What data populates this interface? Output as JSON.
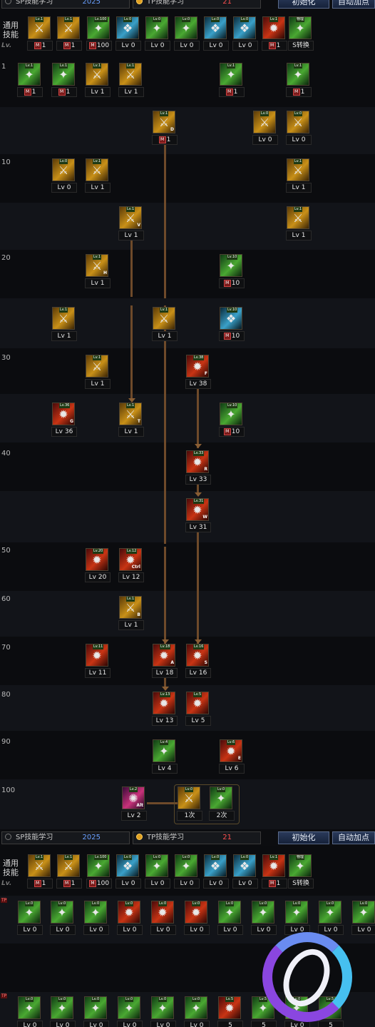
{
  "window": {
    "title": "SP技能学习 / TP技能学习"
  },
  "top_tabs": {
    "sp_label": "SP技能学习",
    "sp_points": "2025",
    "tp_label": "TP技能学习",
    "tp_points": "21",
    "reset_label": "初始化",
    "auto_label": "自动加点"
  },
  "bottom_tabs": {
    "sp_label": "SP技能学习",
    "sp_points": "2025",
    "tp_label": "TP技能学习",
    "tp_points": "21",
    "reset_label": "初始化",
    "auto_label": "自动加点"
  },
  "general_label": "通用\n技能",
  "lv_mark": "Lv.",
  "level_labels": [
    "1",
    "10",
    "20",
    "30",
    "40",
    "50",
    "60",
    "70",
    "80",
    "90",
    "100"
  ],
  "general_skills": [
    {
      "count": "1",
      "m": true,
      "hk": "",
      "tag": "Lv.1",
      "icon": "scroll-icon",
      "color": "gold"
    },
    {
      "count": "1",
      "m": true,
      "hk": "",
      "tag": "Lv.1",
      "icon": "fist-icon",
      "color": "gold"
    },
    {
      "count": "100",
      "m": true,
      "hk": "",
      "tag": "Lv.100",
      "icon": "wind-icon",
      "color": "green"
    },
    {
      "count": "Lv 0",
      "m": false,
      "hk": "",
      "tag": "Lv.0",
      "icon": "wings-icon",
      "color": "cyan"
    },
    {
      "count": "Lv 0",
      "m": false,
      "hk": "",
      "tag": "Lv.0",
      "icon": "target-icon",
      "color": "green"
    },
    {
      "count": "Lv 0",
      "m": false,
      "hk": "",
      "tag": "Lv.0",
      "icon": "figure-icon",
      "color": "green"
    },
    {
      "count": "Lv 0",
      "m": false,
      "hk": "",
      "tag": "Lv.0",
      "icon": "eye-icon",
      "color": "cyan"
    },
    {
      "count": "Lv 0",
      "m": false,
      "hk": "",
      "tag": "Lv.0",
      "icon": "armor-icon",
      "color": "cyan"
    },
    {
      "count": "1",
      "m": true,
      "hk": "",
      "tag": "Lv.1",
      "icon": "flame-icon",
      "color": "red"
    },
    {
      "count": "S转换",
      "m": false,
      "hk": "",
      "tag": "物理",
      "icon": "convert-icon",
      "color": "green"
    }
  ],
  "skills": [
    {
      "name": "skill-1-1",
      "count": "1",
      "m": true,
      "hk": "",
      "tag": "Lv.1",
      "color": "green",
      "icon": "shield-grid-icon"
    },
    {
      "name": "skill-1-2",
      "count": "1",
      "m": true,
      "hk": "",
      "tag": "Lv.1",
      "color": "green",
      "icon": "slash-icon"
    },
    {
      "name": "skill-1-3",
      "count": "Lv 1",
      "m": false,
      "hk": "",
      "tag": "Lv.1",
      "color": "gold",
      "icon": "strike-icon"
    },
    {
      "name": "skill-1-4",
      "count": "Lv 1",
      "m": false,
      "hk": "",
      "tag": "Lv.1",
      "color": "gold",
      "icon": "swing-icon"
    },
    {
      "name": "skill-1-5",
      "count": "1",
      "m": true,
      "hk": "",
      "tag": "Lv.1",
      "color": "green",
      "icon": "spin-icon"
    },
    {
      "name": "skill-1-6",
      "count": "1",
      "m": true,
      "hk": "",
      "tag": "Lv.1",
      "color": "green",
      "icon": "leaf-icon"
    },
    {
      "name": "skill-5-1",
      "count": "1",
      "m": true,
      "hk": "D",
      "tag": "Lv.1",
      "color": "gold",
      "icon": "dash-icon"
    },
    {
      "name": "skill-5-2",
      "count": "Lv 0",
      "m": false,
      "hk": "",
      "tag": "Lv.0",
      "color": "gold",
      "icon": "burst-icon"
    },
    {
      "name": "skill-5-3",
      "count": "Lv 0",
      "m": false,
      "hk": "",
      "tag": "Lv.0",
      "color": "gold",
      "icon": "cross-shield-icon"
    },
    {
      "name": "skill-10-1",
      "count": "Lv 0",
      "m": false,
      "hk": "",
      "tag": "Lv.0",
      "color": "gold",
      "icon": "pierce-icon"
    },
    {
      "name": "skill-10-2",
      "count": "Lv 1",
      "m": false,
      "hk": "",
      "tag": "Lv.1",
      "color": "gold",
      "icon": "double-slash-icon"
    },
    {
      "name": "skill-10-3",
      "count": "Lv 1",
      "m": false,
      "hk": "",
      "tag": "Lv.1",
      "color": "gold",
      "icon": "arc-icon"
    },
    {
      "name": "skill-15-1",
      "count": "Lv 1",
      "m": false,
      "hk": "V",
      "tag": "Lv.1",
      "color": "gold",
      "icon": "rise-icon"
    },
    {
      "name": "skill-15-2",
      "count": "Lv 1",
      "m": false,
      "hk": "",
      "tag": "Lv.1",
      "color": "gold",
      "icon": "crescent-icon"
    },
    {
      "name": "skill-20-1",
      "count": "Lv 1",
      "m": false,
      "hk": "H",
      "tag": "Lv.1",
      "color": "gold",
      "icon": "kick-icon"
    },
    {
      "name": "skill-20-2",
      "count": "10",
      "m": true,
      "hk": "",
      "tag": "Lv.10",
      "color": "green",
      "icon": "claw-icon"
    },
    {
      "name": "skill-25-1",
      "count": "Lv 1",
      "m": false,
      "hk": "",
      "tag": "Lv.1",
      "color": "gold",
      "icon": "blade-icon"
    },
    {
      "name": "skill-25-2",
      "count": "Lv 1",
      "m": false,
      "hk": "",
      "tag": "Lv.1",
      "color": "gold",
      "icon": "thrust-icon"
    },
    {
      "name": "skill-25-3",
      "count": "10",
      "m": true,
      "hk": "",
      "tag": "Lv.10",
      "color": "cyan",
      "icon": "aura-icon"
    },
    {
      "name": "skill-30-1",
      "count": "Lv 1",
      "m": false,
      "hk": "",
      "tag": "Lv.1",
      "color": "gold",
      "icon": "wave-icon"
    },
    {
      "name": "skill-30-2",
      "count": "Lv 38",
      "m": false,
      "hk": "F",
      "tag": "Lv.38",
      "color": "red",
      "icon": "fire-slash-icon"
    },
    {
      "name": "skill-35-1",
      "count": "Lv 36",
      "m": false,
      "hk": "G",
      "tag": "Lv.36",
      "color": "red",
      "icon": "meteor-icon"
    },
    {
      "name": "skill-35-2",
      "count": "Lv 1",
      "m": false,
      "hk": "T",
      "tag": "Lv.1",
      "color": "gold",
      "icon": "star-icon"
    },
    {
      "name": "skill-35-3",
      "count": "10",
      "m": true,
      "hk": "",
      "tag": "Lv.10",
      "color": "green",
      "icon": "vine-icon"
    },
    {
      "name": "skill-40-1",
      "count": "Lv 33",
      "m": false,
      "hk": "R",
      "tag": "Lv.33",
      "color": "red",
      "icon": "fang-icon"
    },
    {
      "name": "skill-45-1",
      "count": "Lv 31",
      "m": false,
      "hk": "W",
      "tag": "Lv.31",
      "color": "red",
      "icon": "storm-icon"
    },
    {
      "name": "skill-50-1",
      "count": "Lv 20",
      "m": false,
      "hk": "",
      "tag": "Lv.20",
      "color": "red",
      "icon": "rage-icon"
    },
    {
      "name": "skill-50-2",
      "count": "Lv 12",
      "m": false,
      "hk": "Ctrl",
      "tag": "Lv.12",
      "color": "red",
      "icon": "flurry-icon"
    },
    {
      "name": "skill-60-1",
      "count": "Lv 1",
      "m": false,
      "hk": "B",
      "tag": "Lv.1",
      "color": "gold",
      "icon": "sunburst-icon"
    },
    {
      "name": "skill-70-1",
      "count": "Lv 11",
      "m": false,
      "hk": "",
      "tag": "Lv.11",
      "color": "red",
      "icon": "cleave-icon"
    },
    {
      "name": "skill-70-2",
      "count": "Lv 18",
      "m": false,
      "hk": "A",
      "tag": "Lv.18",
      "color": "red",
      "icon": "cyclone-icon"
    },
    {
      "name": "skill-70-3",
      "count": "Lv 16",
      "m": false,
      "hk": "S",
      "tag": "Lv.16",
      "color": "red",
      "icon": "hammer-icon"
    },
    {
      "name": "skill-80-1",
      "count": "Lv 13",
      "m": false,
      "hk": "",
      "tag": "Lv.13",
      "color": "red",
      "icon": "lance-icon"
    },
    {
      "name": "skill-80-2",
      "count": "Lv 5",
      "m": false,
      "hk": "",
      "tag": "Lv.5",
      "color": "red",
      "icon": "orb-icon"
    },
    {
      "name": "skill-90-1",
      "count": "Lv 4",
      "m": false,
      "hk": "",
      "tag": "Lv.4",
      "color": "green",
      "icon": "eruption-icon"
    },
    {
      "name": "skill-90-2",
      "count": "Lv 6",
      "m": false,
      "hk": "E",
      "tag": "Lv.6",
      "color": "red",
      "icon": "inferno-icon"
    },
    {
      "name": "skill-100-1",
      "count": "Lv 2",
      "m": false,
      "hk": "Alt",
      "tag": "Lv.2",
      "color": "purple",
      "icon": "awakening-icon"
    },
    {
      "name": "skill-100-2",
      "count": "1次",
      "m": false,
      "hk": "",
      "tag": "Lv.0",
      "color": "gold",
      "icon": "fusion-icon"
    },
    {
      "name": "skill-100-3",
      "count": "2次",
      "m": false,
      "hk": "",
      "tag": "Lv.0",
      "color": "green",
      "icon": "fusion-icon"
    }
  ],
  "tp_row_1": [
    {
      "count": "Lv 0",
      "tag": "Lv.0",
      "color": "green",
      "icon": "dash-tp-icon"
    },
    {
      "count": "Lv 0",
      "tag": "Lv.0",
      "color": "green",
      "icon": "slash-tp-icon"
    },
    {
      "count": "Lv 0",
      "tag": "Lv.0",
      "color": "green",
      "icon": "swing-tp-icon"
    },
    {
      "count": "Lv 0",
      "tag": "Lv.0",
      "color": "red",
      "icon": "shield-tp-icon"
    },
    {
      "count": "Lv 0",
      "tag": "Lv.0",
      "color": "red",
      "icon": "burst-tp-icon"
    },
    {
      "count": "Lv 0",
      "tag": "Lv.0",
      "color": "red",
      "icon": "pierce-tp-icon"
    },
    {
      "count": "Lv 0",
      "tag": "Lv.0",
      "color": "green",
      "icon": "arc-tp-icon"
    },
    {
      "count": "Lv 0",
      "tag": "Lv.0",
      "color": "green",
      "icon": "rise-tp-icon"
    },
    {
      "count": "Lv 0",
      "tag": "Lv.0",
      "color": "green",
      "icon": "crescent-tp-icon"
    },
    {
      "count": "Lv 0",
      "tag": "Lv.0",
      "color": "green",
      "icon": "kick-tp-icon"
    },
    {
      "count": "Lv 0",
      "tag": "Lv.0",
      "color": "green",
      "icon": "claw-tp-icon"
    }
  ],
  "tp_row_2": [
    {
      "count": "Lv 0",
      "tag": "Lv.0",
      "color": "green",
      "icon": "blade-tp-icon"
    },
    {
      "count": "Lv 0",
      "tag": "Lv.0",
      "color": "green",
      "icon": "thrust-tp-icon"
    },
    {
      "count": "Lv 0",
      "tag": "Lv.0",
      "color": "green",
      "icon": "wave-tp-icon"
    },
    {
      "count": "Lv 0",
      "tag": "Lv.0",
      "color": "green",
      "icon": "meteor-tp-icon"
    },
    {
      "count": "Lv 0",
      "tag": "Lv.0",
      "color": "green",
      "icon": "star-tp-icon"
    },
    {
      "count": "Lv 0",
      "tag": "Lv.0",
      "color": "green",
      "icon": "vine-tp-icon"
    },
    {
      "count": "5",
      "tag": "Lv.5",
      "color": "red",
      "icon": "fang-tp-icon"
    },
    {
      "count": "5",
      "tag": "Lv.5",
      "color": "green",
      "icon": "storm-tp-icon"
    },
    {
      "count": "Lv 0",
      "tag": "Lv.0",
      "color": "green",
      "icon": "rage-tp-icon"
    },
    {
      "count": "5",
      "tag": "Lv.5",
      "color": "green",
      "icon": "flurry-tp-icon"
    }
  ]
}
